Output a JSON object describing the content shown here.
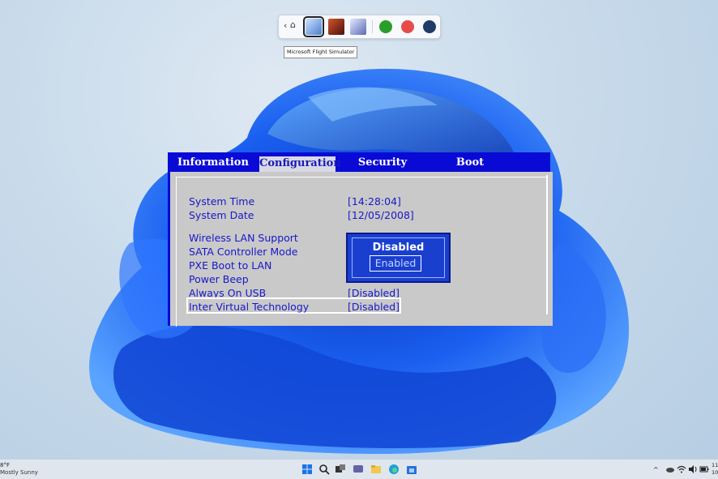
{
  "launcher": {
    "back_glyph": "‹",
    "home_glyph": "⌂",
    "apps": [
      {
        "name": "Microsoft Flight Simulator",
        "color": "#5d8fd6",
        "selected": true
      },
      {
        "name": "game-2",
        "color": "#9a2d1f"
      },
      {
        "name": "game-3",
        "color": "#7a8fc8"
      }
    ],
    "stores": [
      {
        "name": "xbox",
        "color": "#2a9d2a"
      },
      {
        "name": "ea",
        "color": "#e84a4a"
      },
      {
        "name": "steam",
        "color": "#1f3b66"
      }
    ],
    "tooltip": "Microsoft Flight Simulator"
  },
  "bios": {
    "tabs": [
      "Information",
      "Configuration",
      "Security",
      "Boot"
    ],
    "active_tab": "Configuration",
    "rows": [
      {
        "label": "System Time",
        "value": "[14:28:04]"
      },
      {
        "label": "System Date",
        "value": "[12/05/2008]"
      },
      {
        "label": "Wireless LAN Support",
        "value": ""
      },
      {
        "label": "SATA Controller Mode",
        "value": ""
      },
      {
        "label": "PXE Boot to LAN",
        "value": ""
      },
      {
        "label": "Power Beep",
        "value": ""
      },
      {
        "label": "Always On USB",
        "value": "[Disabled]"
      },
      {
        "label": "Inter Virtual Technology",
        "value": "[Disabled]"
      }
    ],
    "selected_row": "Inter Virtual Technology",
    "popup": {
      "option_1": "Disabled",
      "option_2": "Enabled",
      "highlighted": "Enabled"
    },
    "colors": {
      "header": "#0a0ad6",
      "text": "#1818c8",
      "panel": "#c9c9c9",
      "popup": "#1a3fcf"
    }
  },
  "taskbar": {
    "weather_temp": "8°F",
    "weather_desc": "Mostly Sunny",
    "time": "11",
    "date": "10/2"
  }
}
